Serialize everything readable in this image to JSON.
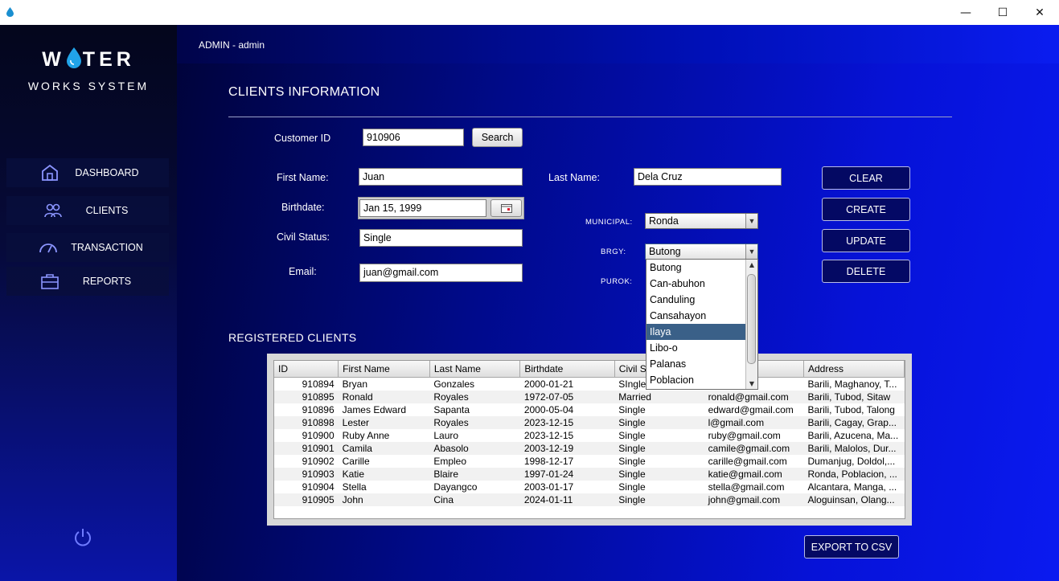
{
  "window": {
    "minimize": "—",
    "maximize": "☐",
    "close": "✕"
  },
  "logo": {
    "title": "WATER",
    "subtitle": "WORKS SYSTEM"
  },
  "sidebar": {
    "items": [
      {
        "label": "DASHBOARD",
        "icon": "home-icon"
      },
      {
        "label": "CLIENTS",
        "icon": "users-icon"
      },
      {
        "label": "TRANSACTION",
        "icon": "gauge-icon"
      },
      {
        "label": "REPORTS",
        "icon": "briefcase-icon"
      }
    ],
    "power_icon": "power-icon"
  },
  "header": {
    "user": "ADMIN -  admin"
  },
  "page": {
    "title": "CLIENTS INFORMATION",
    "registered_title": "REGISTERED CLIENTS"
  },
  "form": {
    "customer_id_label": "Customer ID",
    "customer_id_value": "910906",
    "search_label": "Search",
    "first_name_label": "First Name:",
    "first_name_value": "Juan",
    "last_name_label": "Last Name:",
    "last_name_value": "Dela Cruz",
    "birthdate_label": "Birthdate:",
    "birthdate_value": "Jan 15, 1999",
    "civil_status_label": "Civil Status:",
    "civil_status_value": "Single",
    "email_label": "Email:",
    "email_value": "juan@gmail.com",
    "municipal_label": "MUNICIPAL:",
    "municipal_value": "Ronda",
    "brgy_label": "BRGY:",
    "brgy_value": "Butong",
    "purok_label": "PUROK:"
  },
  "brgy_dropdown": {
    "options": [
      "Butong",
      "Can-abuhon",
      "Canduling",
      "Cansahayon",
      "Ilaya",
      "Libo-o",
      "Palanas",
      "Poblacion"
    ],
    "highlighted": "Ilaya"
  },
  "actions": {
    "clear": "CLEAR",
    "create": "CREATE",
    "update": "UPDATE",
    "delete": "DELETE",
    "export": "EXPORT TO CSV"
  },
  "table": {
    "columns": [
      "ID",
      "First Name",
      "Last Name",
      "Birthdate",
      "Civil S",
      "",
      "Address"
    ],
    "rows": [
      [
        "910894",
        "Bryan",
        "Gonzales",
        "2000-01-21",
        "SIngle",
        ".com",
        "Barili, Maghanoy, T..."
      ],
      [
        "910895",
        "Ronald",
        "Royales",
        "1972-07-05",
        "Married",
        "ronald@gmail.com",
        "Barili, Tubod, Sitaw"
      ],
      [
        "910896",
        "James Edward",
        "Sapanta",
        "2000-05-04",
        "Single",
        "edward@gmail.com",
        "Barili, Tubod, Talong"
      ],
      [
        "910898",
        "Lester",
        "Royales",
        "2023-12-15",
        "Single",
        "l@gmail.com",
        "Barili, Cagay, Grap..."
      ],
      [
        "910900",
        "Ruby Anne",
        "Lauro",
        "2023-12-15",
        "Single",
        "ruby@gmail.com",
        "Barili, Azucena, Ma..."
      ],
      [
        "910901",
        "Camila",
        "Abasolo",
        "2003-12-19",
        "Single",
        "camile@gmail.com",
        "Barili, Malolos, Dur..."
      ],
      [
        "910902",
        "Carille",
        "Empleo",
        "1998-12-17",
        "Single",
        "carille@gmail.com",
        "Dumanjug, Doldol,..."
      ],
      [
        "910903",
        "Katie",
        "Blaire",
        "1997-01-24",
        "Single",
        "katie@gmail.com",
        "Ronda, Poblacion, ..."
      ],
      [
        "910904",
        "Stella",
        "Dayangco",
        "2003-01-17",
        "Single",
        "stella@gmail.com",
        "Alcantara, Manga, ..."
      ],
      [
        "910905",
        "John",
        "Cina",
        "2024-01-11",
        "Single",
        "john@gmail.com",
        "Aloguinsan, Olang..."
      ]
    ]
  }
}
